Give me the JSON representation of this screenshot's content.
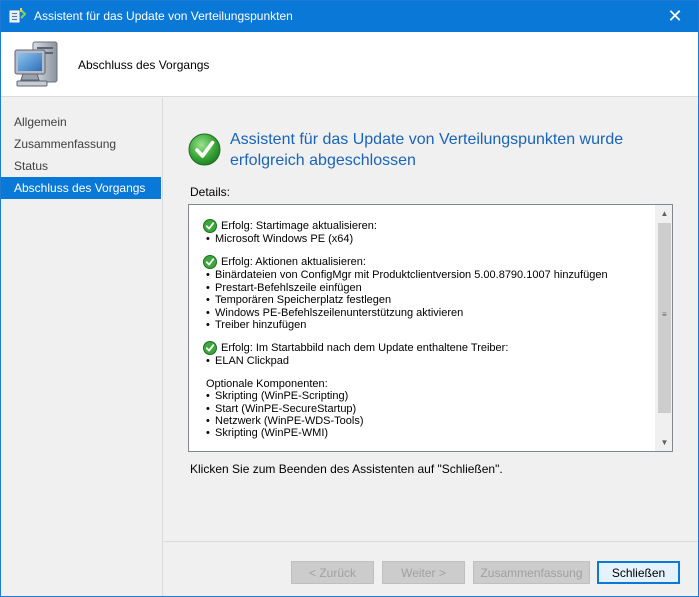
{
  "window": {
    "title": "Assistent für das Update von Verteilungspunkten",
    "close_glyph": "✕"
  },
  "header": {
    "title": "Abschluss des Vorgangs"
  },
  "sidebar": {
    "items": [
      {
        "label": "Allgemein",
        "active": false
      },
      {
        "label": "Zusammenfassung",
        "active": false
      },
      {
        "label": "Status",
        "active": false
      },
      {
        "label": "Abschluss des Vorgangs",
        "active": true
      }
    ]
  },
  "main": {
    "heading": "Assistent für das Update von Verteilungspunkten wurde erfolgreich abgeschlossen",
    "details_label": "Details:",
    "details": {
      "groups": [
        {
          "title": "Erfolg: Startimage aktualisieren:",
          "items": [
            "Microsoft Windows PE (x64)"
          ]
        },
        {
          "title": "Erfolg: Aktionen aktualisieren:",
          "items": [
            "Binärdateien von ConfigMgr mit Produktclientversion 5.00.8790.1007 hinzufügen",
            "Prestart-Befehlszeile einfügen",
            "Temporären Speicherplatz festlegen",
            "Windows PE-Befehlszeilenunterstützung aktivieren",
            "Treiber hinzufügen"
          ]
        },
        {
          "title": "Erfolg: Im Startabbild nach dem Update enthaltene Treiber:",
          "items": [
            "ELAN Clickpad"
          ]
        }
      ],
      "optional": {
        "title": "Optionale Komponenten:",
        "items": [
          "Skripting (WinPE-Scripting)",
          "Start (WinPE-SecureStartup)",
          "Netzwerk (WinPE-WDS-Tools)",
          "Skripting (WinPE-WMI)"
        ]
      }
    },
    "footer_text": "Klicken Sie zum Beenden des Assistenten auf \"Schließen\"."
  },
  "buttons": {
    "back": "< Zurück",
    "next": "Weiter >",
    "summary": "Zusammenfassung",
    "close": "Schließen"
  },
  "colors": {
    "accent": "#0a78d7",
    "heading": "#1a64b8",
    "success": "#3aa83a"
  }
}
